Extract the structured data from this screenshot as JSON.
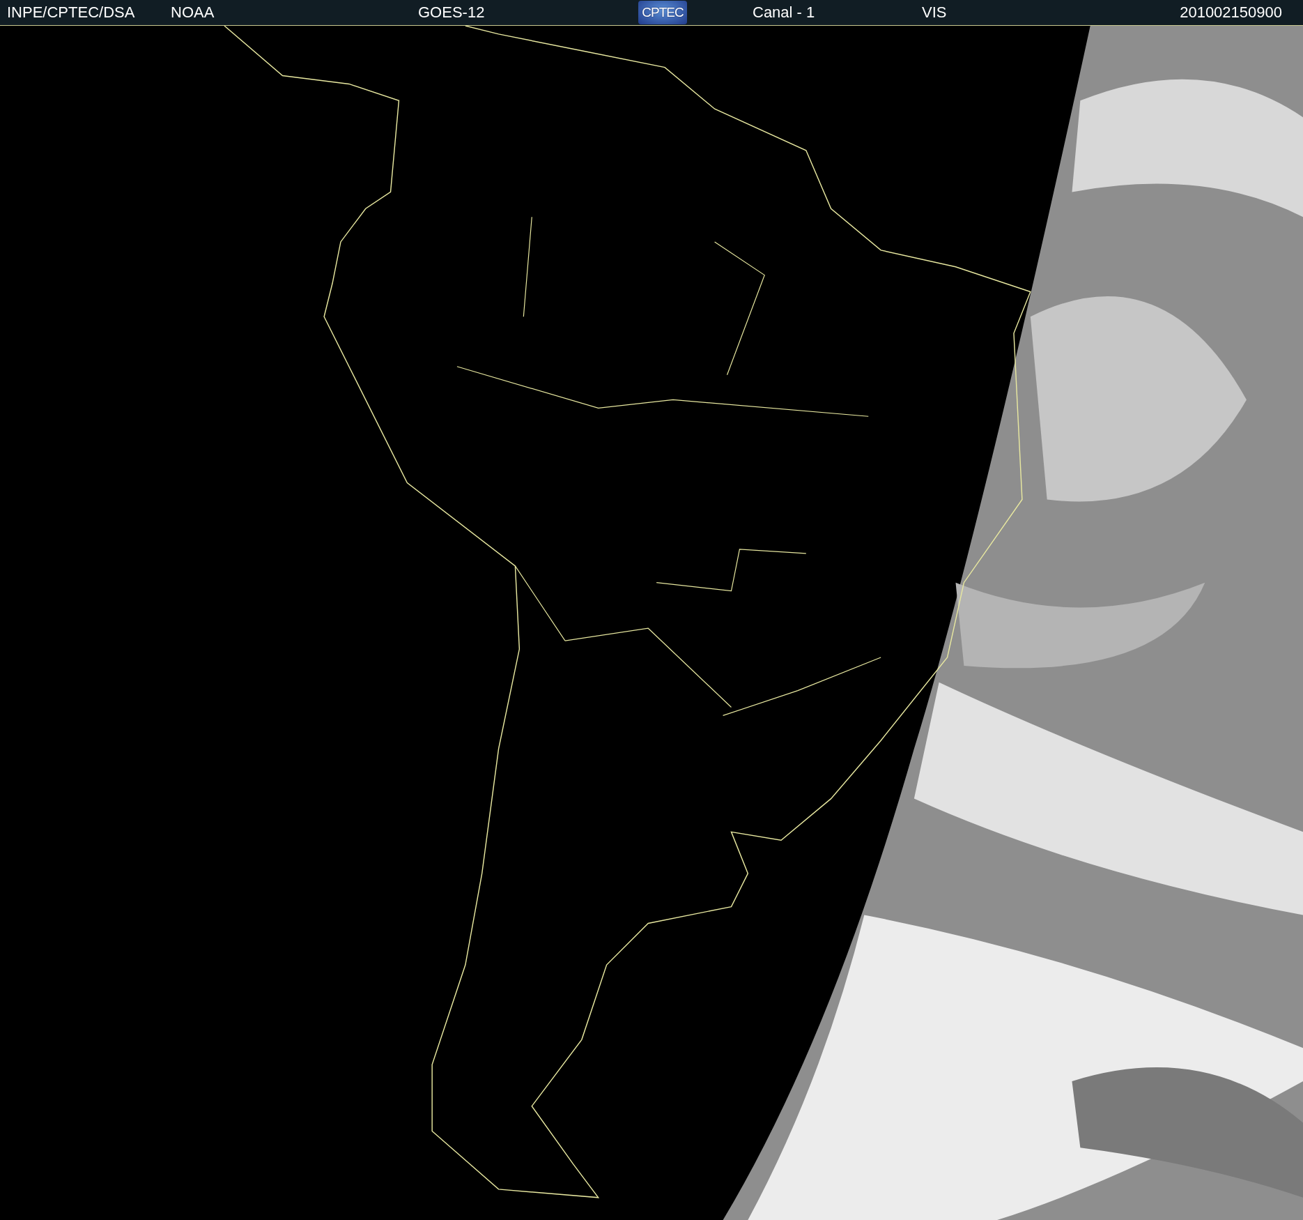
{
  "header": {
    "items": [
      {
        "kind": "text",
        "text": "INPE/CPTEC/DSA"
      },
      {
        "kind": "text",
        "text": "NOAA"
      },
      {
        "kind": "text",
        "text": "GOES-12"
      },
      {
        "kind": "logo",
        "text": "CPTEC"
      },
      {
        "kind": "text",
        "text": "Canal - 1"
      },
      {
        "kind": "text",
        "text": "VIS"
      },
      {
        "kind": "text",
        "text": "201002150900"
      }
    ]
  }
}
